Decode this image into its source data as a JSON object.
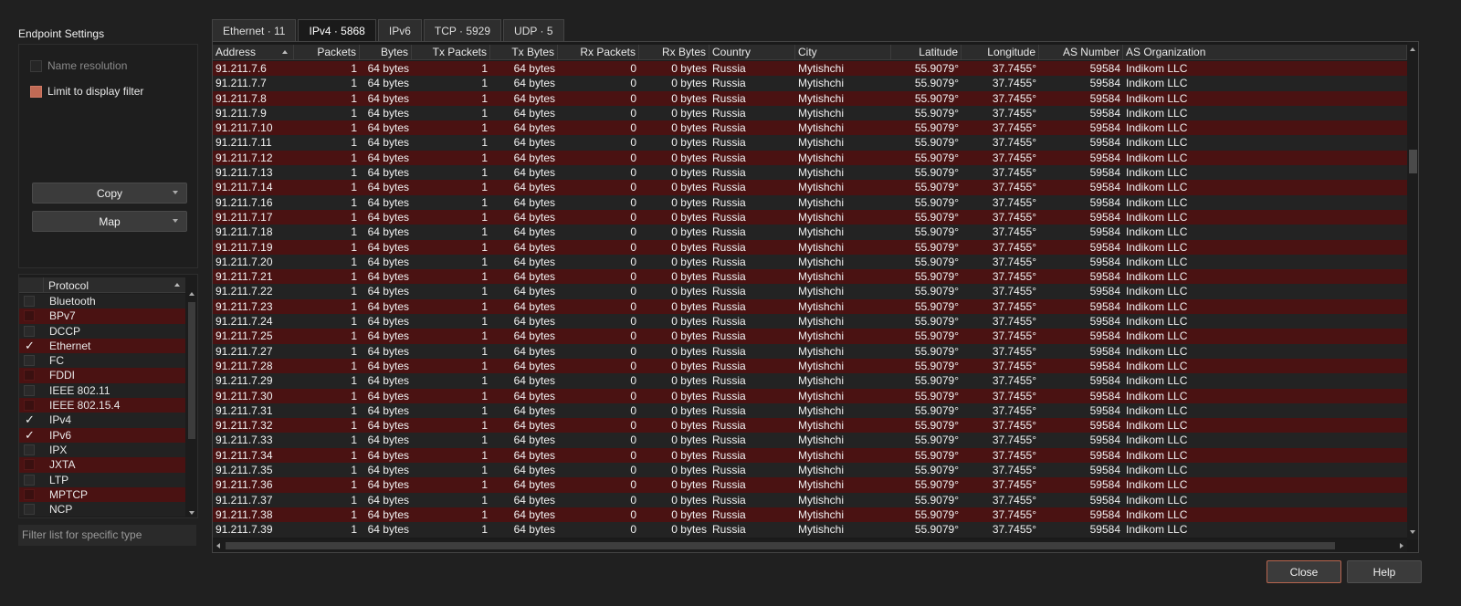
{
  "settings": {
    "title": "Endpoint Settings",
    "name_resolution_label": "Name resolution",
    "limit_filter_label": "Limit to display filter",
    "copy_label": "Copy",
    "map_label": "Map"
  },
  "protocols": {
    "header": "Protocol",
    "items": [
      {
        "label": "Bluetooth",
        "checked": false
      },
      {
        "label": "BPv7",
        "checked": false
      },
      {
        "label": "DCCP",
        "checked": false
      },
      {
        "label": "Ethernet",
        "checked": true
      },
      {
        "label": "FC",
        "checked": false
      },
      {
        "label": "FDDI",
        "checked": false
      },
      {
        "label": "IEEE 802.11",
        "checked": false
      },
      {
        "label": "IEEE 802.15.4",
        "checked": false
      },
      {
        "label": "IPv4",
        "checked": true
      },
      {
        "label": "IPv6",
        "checked": true
      },
      {
        "label": "IPX",
        "checked": false
      },
      {
        "label": "JXTA",
        "checked": false
      },
      {
        "label": "LTP",
        "checked": false
      },
      {
        "label": "MPTCP",
        "checked": false
      },
      {
        "label": "NCP",
        "checked": false
      }
    ],
    "filter_placeholder": "Filter list for specific type"
  },
  "tabs": [
    {
      "label": "Ethernet · 11",
      "active": false
    },
    {
      "label": "IPv4 · 5868",
      "active": true
    },
    {
      "label": "IPv6",
      "active": false
    },
    {
      "label": "TCP · 5929",
      "active": false
    },
    {
      "label": "UDP · 5",
      "active": false
    }
  ],
  "table": {
    "columns": [
      "Address",
      "Packets",
      "Bytes",
      "Tx Packets",
      "Tx Bytes",
      "Rx Packets",
      "Rx Bytes",
      "Country",
      "City",
      "Latitude",
      "Longitude",
      "AS Number",
      "AS Organization"
    ],
    "rows": [
      [
        "91.211.7.6",
        "1",
        "64 bytes",
        "1",
        "64 bytes",
        "0",
        "0 bytes",
        "Russia",
        "Mytishchi",
        "55.9079°",
        "37.7455°",
        "59584",
        "Indikom LLC"
      ],
      [
        "91.211.7.7",
        "1",
        "64 bytes",
        "1",
        "64 bytes",
        "0",
        "0 bytes",
        "Russia",
        "Mytishchi",
        "55.9079°",
        "37.7455°",
        "59584",
        "Indikom LLC"
      ],
      [
        "91.211.7.8",
        "1",
        "64 bytes",
        "1",
        "64 bytes",
        "0",
        "0 bytes",
        "Russia",
        "Mytishchi",
        "55.9079°",
        "37.7455°",
        "59584",
        "Indikom LLC"
      ],
      [
        "91.211.7.9",
        "1",
        "64 bytes",
        "1",
        "64 bytes",
        "0",
        "0 bytes",
        "Russia",
        "Mytishchi",
        "55.9079°",
        "37.7455°",
        "59584",
        "Indikom LLC"
      ],
      [
        "91.211.7.10",
        "1",
        "64 bytes",
        "1",
        "64 bytes",
        "0",
        "0 bytes",
        "Russia",
        "Mytishchi",
        "55.9079°",
        "37.7455°",
        "59584",
        "Indikom LLC"
      ],
      [
        "91.211.7.11",
        "1",
        "64 bytes",
        "1",
        "64 bytes",
        "0",
        "0 bytes",
        "Russia",
        "Mytishchi",
        "55.9079°",
        "37.7455°",
        "59584",
        "Indikom LLC"
      ],
      [
        "91.211.7.12",
        "1",
        "64 bytes",
        "1",
        "64 bytes",
        "0",
        "0 bytes",
        "Russia",
        "Mytishchi",
        "55.9079°",
        "37.7455°",
        "59584",
        "Indikom LLC"
      ],
      [
        "91.211.7.13",
        "1",
        "64 bytes",
        "1",
        "64 bytes",
        "0",
        "0 bytes",
        "Russia",
        "Mytishchi",
        "55.9079°",
        "37.7455°",
        "59584",
        "Indikom LLC"
      ],
      [
        "91.211.7.14",
        "1",
        "64 bytes",
        "1",
        "64 bytes",
        "0",
        "0 bytes",
        "Russia",
        "Mytishchi",
        "55.9079°",
        "37.7455°",
        "59584",
        "Indikom LLC"
      ],
      [
        "91.211.7.16",
        "1",
        "64 bytes",
        "1",
        "64 bytes",
        "0",
        "0 bytes",
        "Russia",
        "Mytishchi",
        "55.9079°",
        "37.7455°",
        "59584",
        "Indikom LLC"
      ],
      [
        "91.211.7.17",
        "1",
        "64 bytes",
        "1",
        "64 bytes",
        "0",
        "0 bytes",
        "Russia",
        "Mytishchi",
        "55.9079°",
        "37.7455°",
        "59584",
        "Indikom LLC"
      ],
      [
        "91.211.7.18",
        "1",
        "64 bytes",
        "1",
        "64 bytes",
        "0",
        "0 bytes",
        "Russia",
        "Mytishchi",
        "55.9079°",
        "37.7455°",
        "59584",
        "Indikom LLC"
      ],
      [
        "91.211.7.19",
        "1",
        "64 bytes",
        "1",
        "64 bytes",
        "0",
        "0 bytes",
        "Russia",
        "Mytishchi",
        "55.9079°",
        "37.7455°",
        "59584",
        "Indikom LLC"
      ],
      [
        "91.211.7.20",
        "1",
        "64 bytes",
        "1",
        "64 bytes",
        "0",
        "0 bytes",
        "Russia",
        "Mytishchi",
        "55.9079°",
        "37.7455°",
        "59584",
        "Indikom LLC"
      ],
      [
        "91.211.7.21",
        "1",
        "64 bytes",
        "1",
        "64 bytes",
        "0",
        "0 bytes",
        "Russia",
        "Mytishchi",
        "55.9079°",
        "37.7455°",
        "59584",
        "Indikom LLC"
      ],
      [
        "91.211.7.22",
        "1",
        "64 bytes",
        "1",
        "64 bytes",
        "0",
        "0 bytes",
        "Russia",
        "Mytishchi",
        "55.9079°",
        "37.7455°",
        "59584",
        "Indikom LLC"
      ],
      [
        "91.211.7.23",
        "1",
        "64 bytes",
        "1",
        "64 bytes",
        "0",
        "0 bytes",
        "Russia",
        "Mytishchi",
        "55.9079°",
        "37.7455°",
        "59584",
        "Indikom LLC"
      ],
      [
        "91.211.7.24",
        "1",
        "64 bytes",
        "1",
        "64 bytes",
        "0",
        "0 bytes",
        "Russia",
        "Mytishchi",
        "55.9079°",
        "37.7455°",
        "59584",
        "Indikom LLC"
      ],
      [
        "91.211.7.25",
        "1",
        "64 bytes",
        "1",
        "64 bytes",
        "0",
        "0 bytes",
        "Russia",
        "Mytishchi",
        "55.9079°",
        "37.7455°",
        "59584",
        "Indikom LLC"
      ],
      [
        "91.211.7.27",
        "1",
        "64 bytes",
        "1",
        "64 bytes",
        "0",
        "0 bytes",
        "Russia",
        "Mytishchi",
        "55.9079°",
        "37.7455°",
        "59584",
        "Indikom LLC"
      ],
      [
        "91.211.7.28",
        "1",
        "64 bytes",
        "1",
        "64 bytes",
        "0",
        "0 bytes",
        "Russia",
        "Mytishchi",
        "55.9079°",
        "37.7455°",
        "59584",
        "Indikom LLC"
      ],
      [
        "91.211.7.29",
        "1",
        "64 bytes",
        "1",
        "64 bytes",
        "0",
        "0 bytes",
        "Russia",
        "Mytishchi",
        "55.9079°",
        "37.7455°",
        "59584",
        "Indikom LLC"
      ],
      [
        "91.211.7.30",
        "1",
        "64 bytes",
        "1",
        "64 bytes",
        "0",
        "0 bytes",
        "Russia",
        "Mytishchi",
        "55.9079°",
        "37.7455°",
        "59584",
        "Indikom LLC"
      ],
      [
        "91.211.7.31",
        "1",
        "64 bytes",
        "1",
        "64 bytes",
        "0",
        "0 bytes",
        "Russia",
        "Mytishchi",
        "55.9079°",
        "37.7455°",
        "59584",
        "Indikom LLC"
      ],
      [
        "91.211.7.32",
        "1",
        "64 bytes",
        "1",
        "64 bytes",
        "0",
        "0 bytes",
        "Russia",
        "Mytishchi",
        "55.9079°",
        "37.7455°",
        "59584",
        "Indikom LLC"
      ],
      [
        "91.211.7.33",
        "1",
        "64 bytes",
        "1",
        "64 bytes",
        "0",
        "0 bytes",
        "Russia",
        "Mytishchi",
        "55.9079°",
        "37.7455°",
        "59584",
        "Indikom LLC"
      ],
      [
        "91.211.7.34",
        "1",
        "64 bytes",
        "1",
        "64 bytes",
        "0",
        "0 bytes",
        "Russia",
        "Mytishchi",
        "55.9079°",
        "37.7455°",
        "59584",
        "Indikom LLC"
      ],
      [
        "91.211.7.35",
        "1",
        "64 bytes",
        "1",
        "64 bytes",
        "0",
        "0 bytes",
        "Russia",
        "Mytishchi",
        "55.9079°",
        "37.7455°",
        "59584",
        "Indikom LLC"
      ],
      [
        "91.211.7.36",
        "1",
        "64 bytes",
        "1",
        "64 bytes",
        "0",
        "0 bytes",
        "Russia",
        "Mytishchi",
        "55.9079°",
        "37.7455°",
        "59584",
        "Indikom LLC"
      ],
      [
        "91.211.7.37",
        "1",
        "64 bytes",
        "1",
        "64 bytes",
        "0",
        "0 bytes",
        "Russia",
        "Mytishchi",
        "55.9079°",
        "37.7455°",
        "59584",
        "Indikom LLC"
      ],
      [
        "91.211.7.38",
        "1",
        "64 bytes",
        "1",
        "64 bytes",
        "0",
        "0 bytes",
        "Russia",
        "Mytishchi",
        "55.9079°",
        "37.7455°",
        "59584",
        "Indikom LLC"
      ],
      [
        "91.211.7.39",
        "1",
        "64 bytes",
        "1",
        "64 bytes",
        "0",
        "0 bytes",
        "Russia",
        "Mytishchi",
        "55.9079°",
        "37.7455°",
        "59584",
        "Indikom LLC"
      ]
    ]
  },
  "buttons": {
    "close_label": "Close",
    "help_label": "Help"
  },
  "colors": {
    "row_highlight": "#4a1212",
    "row_plain": "#232323",
    "accent": "#c06a55"
  }
}
